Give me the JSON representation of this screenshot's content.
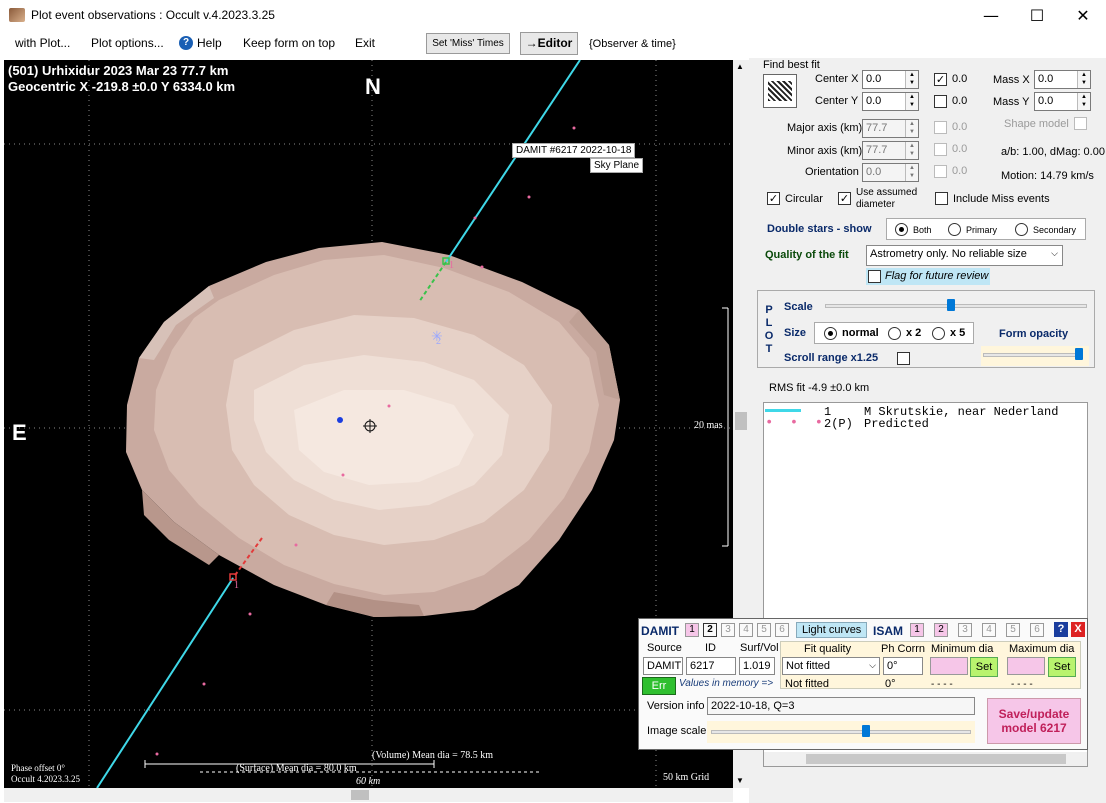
{
  "window": {
    "title": "Plot event observations : Occult v.4.2023.3.25",
    "minimize": "—",
    "maximize": "☐",
    "close": "✕"
  },
  "menu": {
    "items": [
      "with Plot...",
      "Plot options...",
      "Help",
      "Keep form on top",
      "Exit"
    ],
    "set_miss_times": "Set 'Miss' Times",
    "editor": "→Editor",
    "observer_time": "{Observer & time}"
  },
  "plot": {
    "header_line1": "(501) Urhixidur  2023 Mar 23   77.7 km",
    "header_line2": "Geocentric  X  -219.8 ±0.0  Y 6334.0 km",
    "north_label": "N",
    "east_label": "E",
    "damit_label": "DAMIT #6217 2022-10-18",
    "sky_plane": "Sky Plane",
    "scale_label": "20 mas",
    "chord_1_label": "1",
    "chord_2_label": "2",
    "chord_1b_label": "1",
    "phase_offset": "Phase offset 0°",
    "version": "Occult 4.2023.3.25",
    "volume_dia": "(Volume) Mean dia = 78.5 km",
    "surface_dia": "(Surface) Mean dia = 80.0 km",
    "km60": "60 km",
    "grid": "50 km Grid"
  },
  "fit": {
    "find_best_fit": "Find best fit",
    "center_x_label": "Center X",
    "center_x_value": "0.0",
    "center_x_check": "0.0",
    "center_y_label": "Center Y",
    "center_y_value": "0.0",
    "center_y_check": "0.0",
    "mass_x_label": "Mass X",
    "mass_x_value": "0.0",
    "mass_y_label": "Mass Y",
    "mass_y_value": "0.0",
    "shape_model": "Shape model",
    "major_axis_label": "Major axis (km)",
    "major_axis_value": "77.7",
    "major_check": "0.0",
    "minor_axis_label": "Minor axis (km)",
    "minor_axis_value": "77.7",
    "minor_check": "0.0",
    "orientation_label": "Orientation",
    "orientation_value": "0.0",
    "orient_check": "0.0",
    "ab_dmag": "a/b: 1.00, dMag: 0.00",
    "motion": "Motion: 14.79 km/s",
    "circular": "Circular",
    "use_assumed": "Use assumed diameter",
    "include_miss": "Include Miss events",
    "double_stars_label": "Double stars - show",
    "ds_both": "Both",
    "ds_primary": "Primary",
    "ds_secondary": "Secondary",
    "quality_label": "Quality of the fit",
    "quality_value": "Astrometry only. No reliable size",
    "flag_review": "Flag for future review"
  },
  "plotbox": {
    "plot_letters": [
      "P",
      "L",
      "O",
      "T"
    ],
    "scale": "Scale",
    "size": "Size",
    "normal": "normal",
    "x2": "x 2",
    "x5": "x 5",
    "form_opacity": "Form opacity",
    "scroll_range": "Scroll range x1.25",
    "scale_level": 0.48,
    "opacity_level": 1.0
  },
  "rms": "RMS fit -4.9 ±0.0 km",
  "legend": [
    {
      "num": "1",
      "name": "M Skrutskie, near Nederland"
    },
    {
      "num": "2(P)",
      "name": "Predicted"
    }
  ],
  "damit_panel": {
    "damit": "DAMIT",
    "nums": [
      "1",
      "2",
      "3",
      "4",
      "5",
      "6"
    ],
    "light_curves": "Light curves",
    "isam": "ISAM",
    "isam_nums": [
      "1",
      "2",
      "3",
      "4",
      "5",
      "6"
    ],
    "help": "?",
    "close": "X",
    "source_h": "Source",
    "id_h": "ID",
    "surfvol_h": "Surf/Vol",
    "source": "DAMIT",
    "id": "6217",
    "surfvol": "1.019",
    "fit_quality_h": "Fit quality",
    "fit_quality": "Not fitted",
    "fit_quality2": "Not fitted",
    "phcorr_h": "Ph Corrn",
    "phcorr": "0°",
    "phcorr2": "0°",
    "mindia_h": "Minimum dia",
    "maxdia_h": "Maximum dia",
    "set": "Set",
    "dashes": "- - - -",
    "err": "Err",
    "values_mem": "Values in memory =>",
    "version_info_label": "Version info",
    "version_info": "2022-10-18, Q=3",
    "image_scale": "Image scale",
    "image_scale_level": 0.6,
    "save": "Save/update model 6217"
  },
  "colors": {
    "chord": "#3fd8e8",
    "asteroid": "#e8d5cc",
    "plot_bg": "#000000",
    "pink": "#f6c6e8",
    "green": "#2fbf2f"
  }
}
